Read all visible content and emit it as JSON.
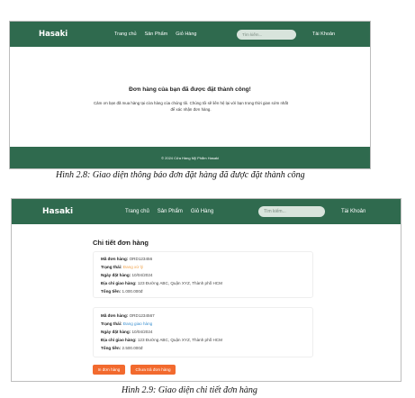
{
  "shot1": {
    "logo": "Hasaki",
    "menu": [
      "Trang chủ",
      "Sản Phẩm",
      "Giỏ Hàng"
    ],
    "search_placeholder": "Tìm kiếm...",
    "account": "Tài Khoản",
    "success_title": "Đơn hàng của bạn đã được đặt thành công!",
    "success_message": "Cảm ơn bạn đã mua hàng tại cửa hàng của chúng tôi. Chúng tôi sẽ liên hệ lại với bạn trong thời gian sớm nhất để xác nhận đơn hàng.",
    "footer": "© 2024 Cửa Hàng Mỹ Phẩm Hasaki"
  },
  "caption1": "Hình 2.8: Giao diện thông báo đơn đặt hàng đã được đặt thành công",
  "shot2": {
    "logo": "Hasaki",
    "menu": [
      "Trang chủ",
      "Sản Phẩm",
      "Giỏ Hàng"
    ],
    "search_placeholder": "Tìm kiếm...",
    "account": "Tài Khoản",
    "detail_title": "Chi tiết đơn hàng",
    "labels": {
      "order_id": "Mã đơn hàng:",
      "status": "Trạng thái:",
      "date": "Ngày đặt hàng:",
      "address": "Địa chỉ giao hàng:",
      "total": "Tổng tiền:"
    },
    "orders": [
      {
        "order_id": "ORD123456",
        "status": "Đang xử lý",
        "date": "10/04/2024",
        "address": "123 Đường ABC, Quận XYZ, Thành phố HCM",
        "total": "1.000.000đ"
      },
      {
        "order_id": "ORD1234567",
        "status": "Đang giao hàng",
        "date": "10/04/2024",
        "address": "123 Đường ABC, Quận XYZ, Thành phố HCM",
        "total": "2.500.000đ"
      }
    ],
    "buttons": {
      "print": "In đơn hàng",
      "pay": "Chưa trả đơn hàng"
    }
  },
  "caption2": "Hình 2.9: Giao diện chi tiết đơn hàng",
  "colors": {
    "nav": "#2f6a4e",
    "button": "#f26a2e",
    "status_processing": "#f0a24a",
    "status_shipping": "#3a8fd0"
  }
}
